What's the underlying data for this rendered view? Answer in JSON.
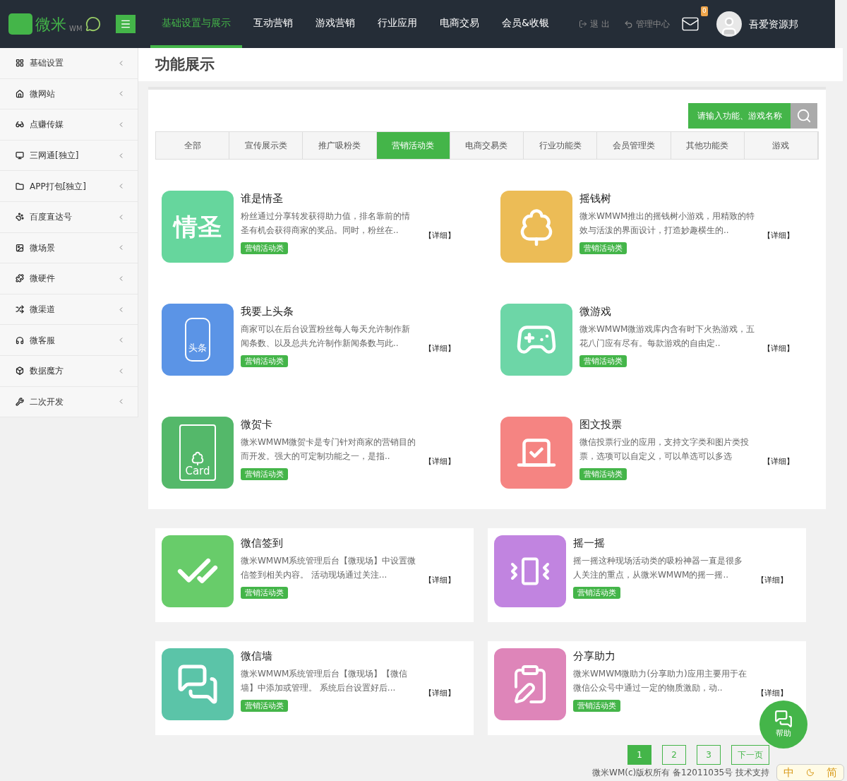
{
  "header": {
    "logo_text": "微米",
    "logo_sub": "WM",
    "nav": [
      {
        "label": "基础设置与展示",
        "selected": true
      },
      {
        "label": "互动营销",
        "selected": false
      },
      {
        "label": "游戏营销",
        "selected": false
      },
      {
        "label": "行业应用",
        "selected": false
      },
      {
        "label": "电商交易",
        "selected": false
      },
      {
        "label": "会员&收银",
        "selected": false
      }
    ],
    "logout": "退 出",
    "admin": "管理中心",
    "mail_badge": "0",
    "username": "吾爱资源邦"
  },
  "sidebar": {
    "items": [
      {
        "label": "基础设置"
      },
      {
        "label": "微网站"
      },
      {
        "label": "点赚传媒"
      },
      {
        "label": "三网通[独立]"
      },
      {
        "label": "APP打包[独立]"
      },
      {
        "label": "百度直达号"
      },
      {
        "label": "微场景"
      },
      {
        "label": "微硬件"
      },
      {
        "label": "微渠道"
      },
      {
        "label": "微客服"
      },
      {
        "label": "数据魔方"
      },
      {
        "label": "二次开发"
      }
    ]
  },
  "page_title": "功能展示",
  "search": {
    "placeholder": "请输入功能、游戏名称"
  },
  "tabs": [
    {
      "label": "全部",
      "selected": false
    },
    {
      "label": "宣传展示类",
      "selected": false
    },
    {
      "label": "推广吸粉类",
      "selected": false
    },
    {
      "label": "营销活动类",
      "selected": true
    },
    {
      "label": "电商交易类",
      "selected": false
    },
    {
      "label": "行业功能类",
      "selected": false
    },
    {
      "label": "会员管理类",
      "selected": false
    },
    {
      "label": "其他功能类",
      "selected": false
    },
    {
      "label": "游戏",
      "selected": false
    }
  ],
  "cards": [
    {
      "title": "谁是情圣",
      "desc": "粉丝通过分享转发获得助力值，排名靠前的情圣有机会获得商家的奖品。同时，粉丝在..",
      "tag": "营销活动类",
      "detail": "【详细】",
      "kind": "text",
      "icon_text": "情圣",
      "color": "#66d69d"
    },
    {
      "title": "摇钱树",
      "desc": "微米WMWM推出的摇钱树小游戏，用精致的特效与活泼的界面设计，打造妙趣横生的..",
      "tag": "营销活动类",
      "detail": "【详细】",
      "kind": "tree",
      "color": "#ecbc56"
    },
    {
      "title": "我要上头条",
      "desc": "商家可以在后台设置粉丝每人每天允许制作新闻条数、以及总共允许制作新闻条数与此..",
      "tag": "营销活动类",
      "detail": "【详细】",
      "kind": "label",
      "icon_text": "头条",
      "color": "#5b94e6"
    },
    {
      "title": "微游戏",
      "desc": "微米WMWM微游戏库内含有时下火热游戏，五花八门应有尽有。每款游戏的自由定..",
      "tag": "营销活动类",
      "detail": "【详细】",
      "kind": "gamepad",
      "color": "#6dd6a7"
    },
    {
      "title": "微贺卡",
      "desc": "微米WMWM微贺卡是专门针对商家的营销目的而开发。强大的可定制功能之一，是指..",
      "tag": "营销活动类",
      "detail": "【详细】",
      "kind": "card",
      "icon_text": "Card",
      "color": "#54b86a"
    },
    {
      "title": "图文投票",
      "desc": "微信投票行业的应用，支持文字类和图片类投票，选项可以自定义，可以单选可以多选",
      "tag": "营销活动类",
      "detail": "【详细】",
      "kind": "ballot",
      "color": "#f58482"
    },
    {
      "title": "微信签到",
      "desc": "微米WMWM系统管理后台【微现场】中设置微信签到相关内容。 活动现场通过关注...",
      "tag": "营销活动类",
      "detail": "【详细】",
      "kind": "check",
      "color": "#68cc6a"
    },
    {
      "title": "摇一摇",
      "desc": "摇一摇这种现场活动类的吸粉神器一直是很多人关注的重点，从微米WMWM的摇一摇..",
      "tag": "营销活动类",
      "detail": "【详细】",
      "kind": "phone",
      "color": "#c184e0"
    },
    {
      "title": "微信墙",
      "desc": "微米WMWM系统管理后台【微现场】【微信墙】中添加或管理。 系统后台设置好后...",
      "tag": "营销活动类",
      "detail": "【详细】",
      "kind": "chat",
      "color": "#5bc4a8"
    },
    {
      "title": "分享助力",
      "desc": "微米WMWM微助力(分享助力)应用主要用于在微信公众号中通过一定的物质激励，动..",
      "tag": "营销活动类",
      "detail": "【详细】",
      "kind": "doc",
      "color": "#de85b9"
    }
  ],
  "help": {
    "label": "帮助"
  },
  "pagination": [
    {
      "label": "1",
      "selected": true
    },
    {
      "label": "2",
      "selected": false
    },
    {
      "label": "3",
      "selected": false
    },
    {
      "label": "下一页",
      "selected": false
    }
  ],
  "footer": "微米WM(c)版权所有 备12011035号 技术支持",
  "ime": {
    "mode": "中",
    "script": "简"
  }
}
